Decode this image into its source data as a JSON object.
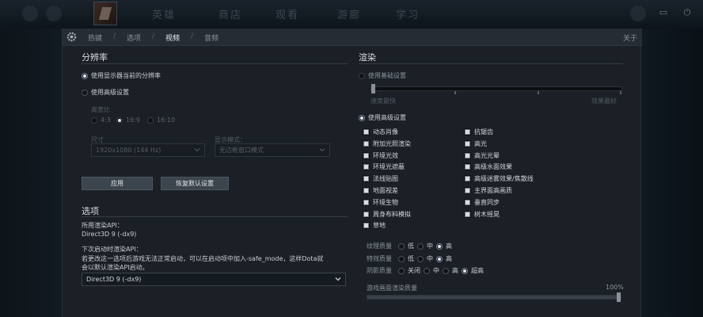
{
  "topbar": {
    "nav": [
      "英雄",
      "商店",
      "观看",
      "游廊",
      "学习"
    ]
  },
  "header": {
    "tabs": [
      "热键",
      "选项",
      "视频",
      "音频"
    ],
    "active_tab": "视频",
    "close_label": "关于"
  },
  "resolution": {
    "title": "分辨率",
    "use_current": "使用显示器当前的分辨率",
    "use_advanced": "使用高级设置",
    "aspect_label": "高宽比",
    "aspects": [
      "4:3",
      "16:9",
      "16:10"
    ],
    "size_label": "尺寸",
    "size_value": "1920x1080 (144 Hz)",
    "display_mode_label": "显示模式：",
    "display_mode_value": "无边框窗口模式",
    "apply_button": "应用",
    "reset_button": "恢复默认设置"
  },
  "options": {
    "title": "选项",
    "current_api_label": "所用渲染API：",
    "current_api_value": "Direct3D 9 (-dx9)",
    "next_api_label": "下次启动时渲染API：",
    "warning_line1": "若更改这一选项后游戏无法正常启动，可以在启动项中加入-safe_mode，这样Dota就",
    "warning_line2": "会以默认渲染API启动。",
    "api_select_value": "Direct3D 9 (-dx9)"
  },
  "rendering": {
    "title": "渲染",
    "use_basic": "使用基础设置",
    "basic_slider_min": "速度最快",
    "basic_slider_max": "效果最好",
    "use_advanced": "使用高级设置",
    "checkboxes_left": [
      "动态肖像",
      "附加光照渲染",
      "环境光效",
      "环境光遮蔽",
      "法线贴图",
      "地面视差",
      "环境生物",
      "周身布料模拟",
      "草地"
    ],
    "checkboxes_right": [
      "抗锯齿",
      "高光",
      "高光光晕",
      "高级水面效果",
      "高级迷雾效果/焦散线",
      "主界面高画质",
      "垂直同步",
      "树木摇晃"
    ],
    "texture_quality_label": "纹理质量",
    "effects_quality_label": "特效质量",
    "shadow_quality_label": "阴影质量",
    "low": "低",
    "mid": "中",
    "high": "高",
    "off": "关闭",
    "ultra": "超高",
    "render_quality_label": "游戏画面渲染质量",
    "render_quality_value": "100%",
    "render_quality_fraction": 1.0
  }
}
